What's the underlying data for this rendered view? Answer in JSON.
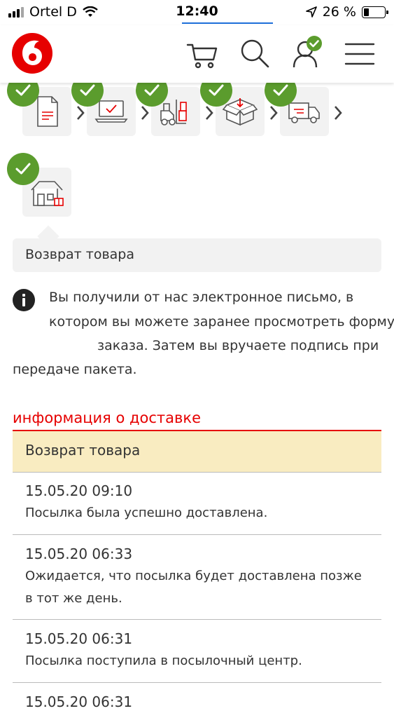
{
  "status_bar": {
    "carrier": "Ortel D",
    "time": "12:40",
    "battery": "26 %",
    "battery_level": 0.26
  },
  "header": {
    "icons": [
      "vodafone-logo",
      "cart-icon",
      "search-icon",
      "account-icon",
      "menu-icon"
    ]
  },
  "steps": {
    "items": [
      {
        "icon": "document-icon",
        "done": true
      },
      {
        "icon": "laptop-icon",
        "done": true
      },
      {
        "icon": "forklift-icon",
        "done": true
      },
      {
        "icon": "box-icon",
        "done": true
      },
      {
        "icon": "truck-icon",
        "done": true
      },
      {
        "icon": "house-icon",
        "done": true
      }
    ],
    "tooltip": "Возврат товара"
  },
  "info": {
    "lines": [
      "Вы получили от нас электронное письмо, в",
      "котором вы можете заранее просмотреть форму",
      "заказа. Затем вы вручаете подпись при",
      "передаче пакета."
    ]
  },
  "delivery": {
    "title": "информация о доставке",
    "head": "Возврат товара",
    "events": [
      {
        "date": "15.05.20 09:10",
        "lines": [
          "Посылка была успешно доставлена."
        ]
      },
      {
        "date": "15.05.20 06:33",
        "lines": [
          "Ожидается, что посылка будет доставлена позже",
          "в тот же день."
        ]
      },
      {
        "date": "15.05.20 06:31",
        "lines": [
          "Посылка поступила в посылочный центр."
        ]
      },
      {
        "date": "15.05.20 06:31",
        "lines": []
      }
    ]
  },
  "colors": {
    "brand_red": "#e60000",
    "check_green": "#5b9c2d",
    "highlight": "#f9ecc1",
    "tile": "#f2f2f2"
  }
}
